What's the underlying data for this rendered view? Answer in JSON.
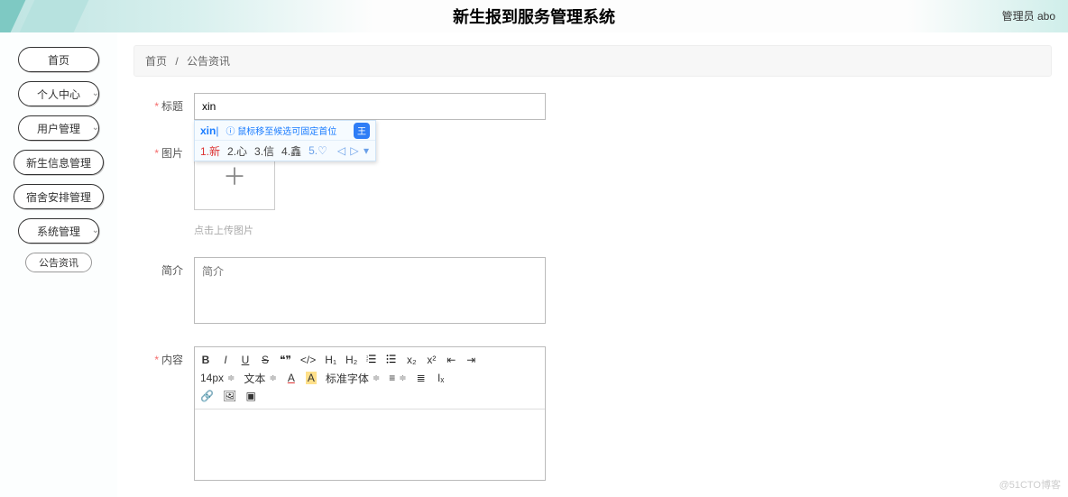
{
  "header": {
    "title": "新生报到服务管理系统",
    "user_label": "管理员 abo"
  },
  "sidebar": {
    "items": [
      {
        "label": "首页",
        "expandable": false
      },
      {
        "label": "个人中心",
        "expandable": true
      },
      {
        "label": "用户管理",
        "expandable": true
      },
      {
        "label": "新生信息管理",
        "expandable": false
      },
      {
        "label": "宿舍安排管理",
        "expandable": false
      },
      {
        "label": "系统管理",
        "expandable": true
      }
    ],
    "sub_item": "公告资讯"
  },
  "breadcrumb": {
    "home": "首页",
    "sep": "/",
    "current": "公告资讯"
  },
  "form": {
    "title_label": "标题",
    "title_value": "xin",
    "image_label": "图片",
    "upload_hint": "点击上传图片",
    "intro_label": "简介",
    "intro_placeholder": "简介",
    "intro_value": "",
    "content_label": "内容"
  },
  "ime": {
    "input": "xin",
    "hint": "ⓘ 鼠标移至候选可固定首位",
    "badge": "王",
    "candidates": [
      "1.新",
      "2.心",
      "3.信",
      "4.鑫",
      "5.♡"
    ],
    "nav": "◁ ▷ ▾"
  },
  "editor": {
    "row1": {
      "bold": "B",
      "italic": "I",
      "under": "U",
      "strike": "S",
      "quote": "❝❞",
      "code": "</>",
      "h1": "H₁",
      "h2": "H₂",
      "ol_icon": "ol",
      "ul_icon": "ul",
      "sub": "x₂",
      "sup": "x²",
      "indent_out": "⇤",
      "indent_in": "⇥"
    },
    "row2": {
      "size": "14px",
      "block": "文本",
      "color_a": "A",
      "bg_a": "A",
      "font": "标准字体",
      "align": "≡",
      "line": "≣",
      "clear": "Iₓ"
    },
    "row3": {
      "link": "🔗",
      "image": "🖼",
      "video": "▣"
    }
  },
  "watermark": "@51CTO博客"
}
